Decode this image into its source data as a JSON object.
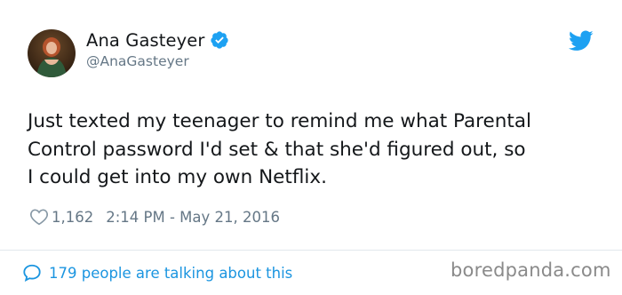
{
  "author": {
    "display_name": "Ana Gasteyer",
    "handle": "@AnaGasteyer",
    "verified_icon": "verified-badge-icon",
    "avatar": "avatar"
  },
  "tweet": {
    "text": "Just texted my teenager to remind me what Parental\nControl password I'd set & that she'd figured out, so\nI could get into my own Netflix.",
    "likes": "1,162",
    "timestamp": "2:14 PM - May 21, 2016"
  },
  "footer": {
    "talking_label": "179 people are talking about this"
  },
  "watermark": {
    "text": "boredpanda.com"
  },
  "icons": {
    "bird": "twitter-bird-icon",
    "heart": "heart-icon",
    "bubble": "comment-bubble-icon"
  },
  "colors": {
    "twitter_blue": "#1da1f2",
    "link_blue": "#1b95e0",
    "muted_gray": "#657786",
    "text": "#14171a"
  }
}
